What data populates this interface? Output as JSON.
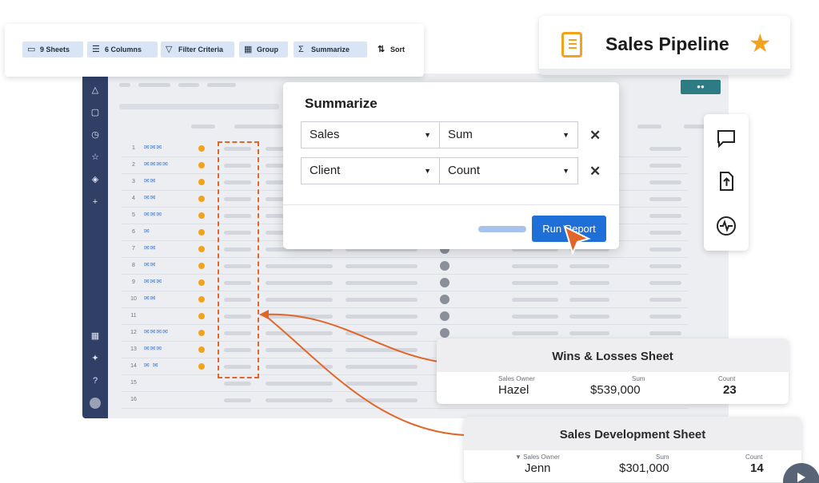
{
  "toolbar": {
    "buttons": [
      {
        "label": "9 Sheets",
        "icon": "sheet-icon"
      },
      {
        "label": "6 Columns",
        "icon": "columns-icon"
      },
      {
        "label": "Filter Criteria",
        "icon": "filter-icon"
      },
      {
        "label": "Group",
        "icon": "group-icon"
      },
      {
        "label": "Summarize",
        "icon": "sigma-icon"
      }
    ],
    "sort_label": "Sort"
  },
  "title_card": {
    "title": "Sales Pipeline",
    "icon": "notebook-icon",
    "star_icon": "star-icon",
    "accent": "#f2a31e"
  },
  "dialog": {
    "title": "Summarize",
    "rows": [
      {
        "field": "Sales",
        "function": "Sum"
      },
      {
        "field": "Client",
        "function": "Count"
      }
    ],
    "run_label": "Run Report",
    "run_color": "#1f6fd9"
  },
  "grid": {
    "row_numbers": [
      "1",
      "2",
      "3",
      "4",
      "5",
      "6",
      "7",
      "8",
      "9",
      "10",
      "11",
      "12",
      "13",
      "14",
      "15",
      "16"
    ]
  },
  "cards": [
    {
      "title": "Wins & Losses Sheet",
      "owner_label": "Sales Owner",
      "owner": "Hazel",
      "sum_label": "Sum",
      "sum": "$539,000",
      "count_label": "Count",
      "count": "23"
    },
    {
      "title": "Sales Development Sheet",
      "owner_label": "Sales Owner",
      "owner": "Jenn",
      "sum_label": "Sum",
      "sum": "$301,000",
      "count_label": "Count",
      "count": "14"
    }
  ],
  "colors": {
    "sidebar": "#2f3f66",
    "highlight": "#e1662a",
    "status_dot": "#f2a31e"
  }
}
